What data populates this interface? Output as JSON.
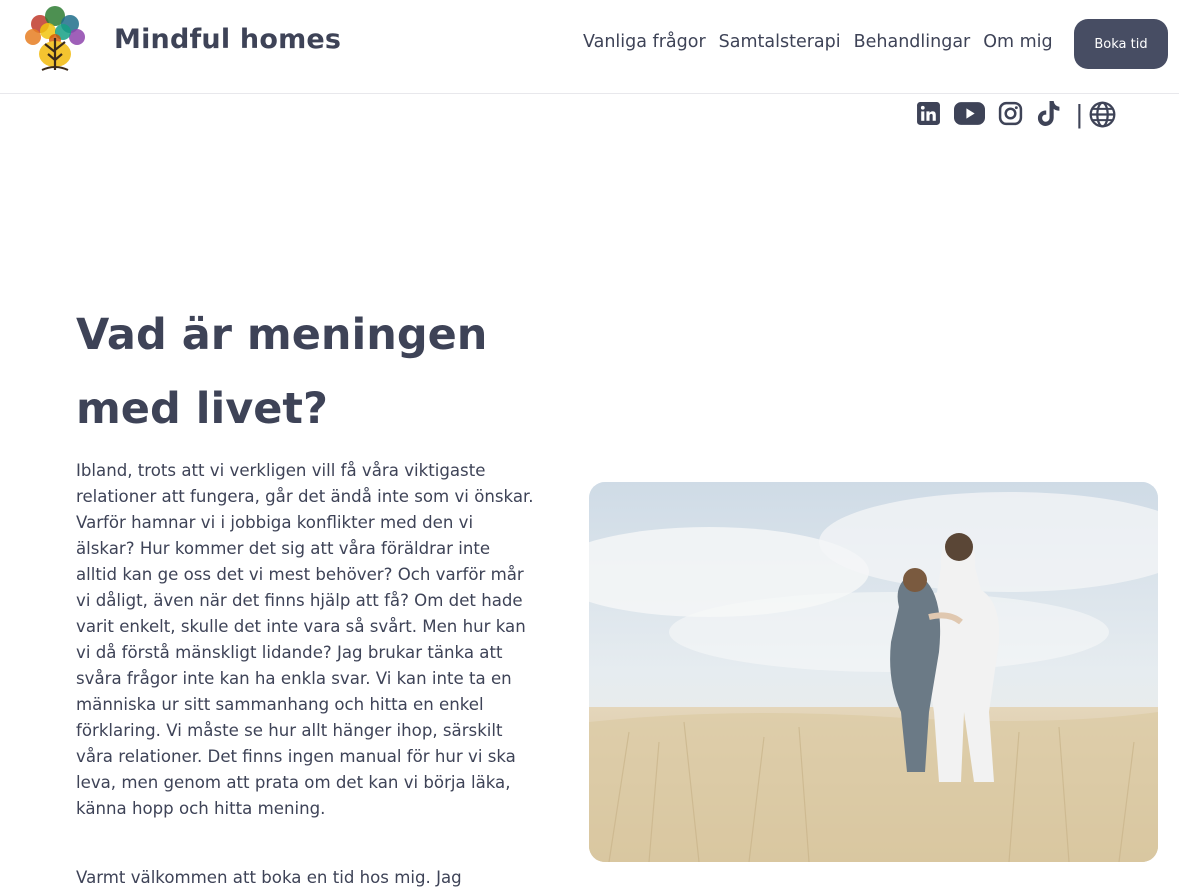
{
  "header": {
    "brand": "Mindful homes",
    "nav": [
      {
        "label": "Vanliga frågor"
      },
      {
        "label": "Samtalsterapi"
      },
      {
        "label": "Behandlingar"
      },
      {
        "label": "Om mig"
      }
    ],
    "cta_label": "Boka tid"
  },
  "social": {
    "icons": [
      "linkedin-icon",
      "youtube-icon",
      "instagram-icon",
      "tiktok-icon",
      "globe-icon"
    ],
    "separator": "|"
  },
  "main": {
    "title": "Vad är meningen med livet?",
    "paragraph1": "Ibland, trots att vi verkligen vill få våra viktigaste relationer att fungera, går det ändå inte som vi önskar. Varför hamnar vi i jobbiga konflikter med den vi älskar? Hur kommer det sig att våra föräldrar inte alltid kan ge oss det vi mest behöver? Och varför mår vi dåligt, även när det finns hjälp att få? Om det hade varit enkelt, skulle det inte vara så svårt. Men hur kan vi då förstå mänskligt lidande? Jag brukar tänka att svåra frågor inte kan ha enkla svar. Vi kan inte ta en människa ur sitt sammanhang och hitta en enkel förklaring. Vi måste se hur allt hänger ihop, särskilt våra relationer. Det finns ingen manual för hur vi ska leva, men genom att prata om det kan vi börja läka, känna hopp och hitta mening.",
    "paragraph2": "Varmt välkommen att boka en tid hos mig. Jag"
  },
  "colors": {
    "text": "#3e4357",
    "cta_bg": "#474d63",
    "background": "#ffffff"
  }
}
